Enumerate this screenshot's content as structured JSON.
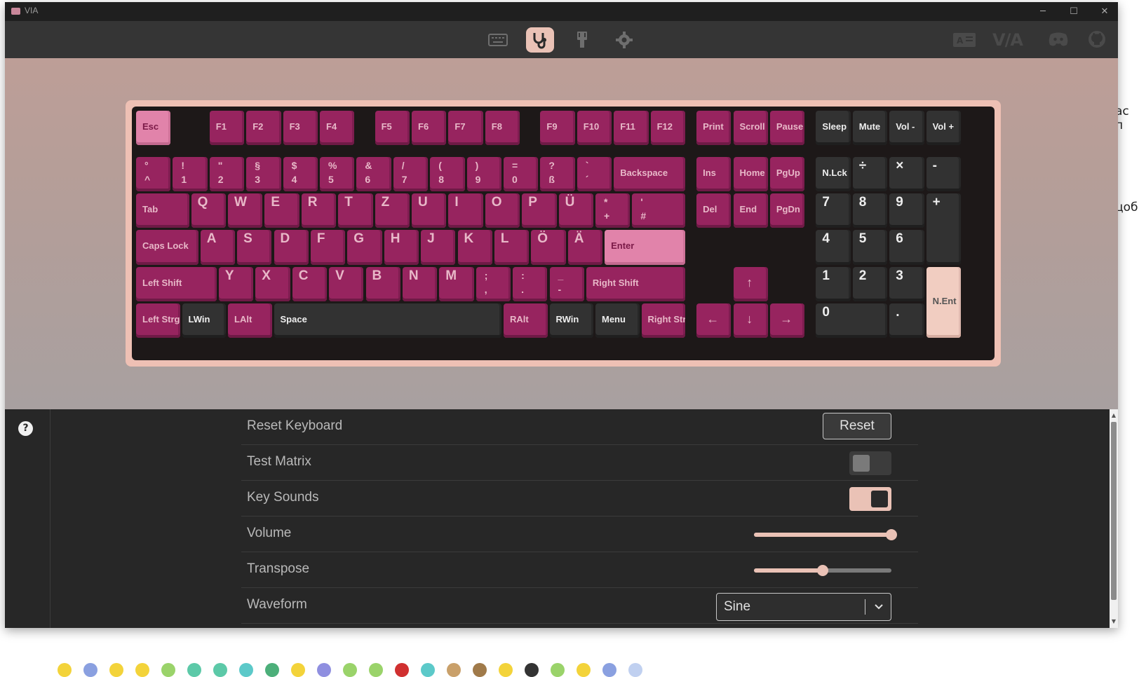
{
  "window": {
    "title": "VIA",
    "controls": {
      "minimize": "─",
      "maximize": "☐",
      "close": "✕"
    }
  },
  "nav": {
    "items": [
      {
        "name": "configure",
        "icon": "keyboard-icon",
        "active": false
      },
      {
        "name": "test",
        "icon": "stethoscope-icon",
        "active": true
      },
      {
        "name": "design",
        "icon": "design-icon",
        "active": false
      },
      {
        "name": "settings",
        "icon": "gear-icon",
        "active": false
      }
    ],
    "right_icons": [
      "language-icon",
      "via-logo",
      "discord-icon",
      "github-icon"
    ],
    "logo_text": "V/A"
  },
  "keyboard": {
    "keys": [
      {
        "l": "Esc",
        "s": "accent"
      },
      {
        "l": "F1"
      },
      {
        "l": "F2"
      },
      {
        "l": "F3"
      },
      {
        "l": "F4"
      },
      {
        "l": "F5"
      },
      {
        "l": "F6"
      },
      {
        "l": "F7"
      },
      {
        "l": "F8"
      },
      {
        "l": "F9"
      },
      {
        "l": "F10"
      },
      {
        "l": "F11"
      },
      {
        "l": "F12"
      },
      {
        "l": "Print"
      },
      {
        "l": "Scroll"
      },
      {
        "l": "Pause"
      },
      {
        "l": "Sleep",
        "s": "dark"
      },
      {
        "l": "Mute",
        "s": "dark"
      },
      {
        "l": "Vol -",
        "s": "dark"
      },
      {
        "l": "Vol +",
        "s": "dark"
      },
      {
        "t": "°",
        "b": "^"
      },
      {
        "t": "!",
        "b": "1"
      },
      {
        "t": "\"",
        "b": "2"
      },
      {
        "t": "§",
        "b": "3"
      },
      {
        "t": "$",
        "b": "4"
      },
      {
        "t": "%",
        "b": "5"
      },
      {
        "t": "&",
        "b": "6"
      },
      {
        "t": "/",
        "b": "7"
      },
      {
        "t": "(",
        "b": "8"
      },
      {
        "t": ")",
        "b": "9"
      },
      {
        "t": "=",
        "b": "0"
      },
      {
        "t": "?",
        "b": "ß"
      },
      {
        "t": "`",
        "b": "´"
      },
      {
        "l": "Backspace"
      },
      {
        "l": "Ins"
      },
      {
        "l": "Home"
      },
      {
        "l": "PgUp"
      },
      {
        "l": "N.Lck",
        "s": "dark"
      },
      {
        "l": "÷",
        "s": "dark",
        "big": true
      },
      {
        "l": "×",
        "s": "dark",
        "big": true
      },
      {
        "l": "-",
        "s": "dark",
        "big": true
      },
      {
        "l": "Tab"
      },
      {
        "l": "Q",
        "big": true
      },
      {
        "l": "W",
        "big": true
      },
      {
        "l": "E",
        "big": true
      },
      {
        "l": "R",
        "big": true
      },
      {
        "l": "T",
        "big": true
      },
      {
        "l": "Z",
        "big": true
      },
      {
        "l": "U",
        "big": true
      },
      {
        "l": "I",
        "big": true
      },
      {
        "l": "O",
        "big": true
      },
      {
        "l": "P",
        "big": true
      },
      {
        "l": "Ü",
        "big": true
      },
      {
        "t": "*",
        "b": "+"
      },
      {
        "t": "'",
        "b": "#"
      },
      {
        "l": "Del"
      },
      {
        "l": "End"
      },
      {
        "l": "PgDn"
      },
      {
        "l": "7",
        "s": "dark",
        "big": true
      },
      {
        "l": "8",
        "s": "dark",
        "big": true
      },
      {
        "l": "9",
        "s": "dark",
        "big": true
      },
      {
        "l": "+",
        "s": "dark",
        "big": true
      },
      {
        "l": "Caps Lock"
      },
      {
        "l": "A",
        "big": true
      },
      {
        "l": "S",
        "big": true
      },
      {
        "l": "D",
        "big": true
      },
      {
        "l": "F",
        "big": true
      },
      {
        "l": "G",
        "big": true
      },
      {
        "l": "H",
        "big": true
      },
      {
        "l": "J",
        "big": true
      },
      {
        "l": "K",
        "big": true
      },
      {
        "l": "L",
        "big": true
      },
      {
        "l": "Ö",
        "big": true
      },
      {
        "l": "Ä",
        "big": true
      },
      {
        "l": "Enter",
        "s": "accent"
      },
      {
        "l": "4",
        "s": "dark",
        "big": true
      },
      {
        "l": "5",
        "s": "dark",
        "big": true
      },
      {
        "l": "6",
        "s": "dark",
        "big": true
      },
      {
        "l": "Left Shift"
      },
      {
        "l": "Y",
        "big": true
      },
      {
        "l": "X",
        "big": true
      },
      {
        "l": "C",
        "big": true
      },
      {
        "l": "V",
        "big": true
      },
      {
        "l": "B",
        "big": true
      },
      {
        "l": "N",
        "big": true
      },
      {
        "l": "M",
        "big": true
      },
      {
        "t": ";",
        "b": ","
      },
      {
        "t": ":",
        "b": "."
      },
      {
        "t": "_",
        "b": "-"
      },
      {
        "l": "Right Shift"
      },
      {
        "l": "↑",
        "arrow": true
      },
      {
        "l": "1",
        "s": "dark",
        "big": true
      },
      {
        "l": "2",
        "s": "dark",
        "big": true
      },
      {
        "l": "3",
        "s": "dark",
        "big": true
      },
      {
        "l": "N.Ent",
        "s": "pale"
      },
      {
        "l": "Left Strg"
      },
      {
        "l": "LWin",
        "s": "dark"
      },
      {
        "l": "LAlt"
      },
      {
        "l": "Space",
        "s": "dark"
      },
      {
        "l": "RAlt"
      },
      {
        "l": "RWin",
        "s": "dark"
      },
      {
        "l": "Menu",
        "s": "dark"
      },
      {
        "l": "Right Str"
      },
      {
        "l": "←",
        "arrow": true
      },
      {
        "l": "↓",
        "arrow": true
      },
      {
        "l": "→",
        "arrow": true
      },
      {
        "l": "0",
        "s": "dark",
        "big": true
      },
      {
        "l": ".",
        "s": "dark",
        "big": true
      }
    ]
  },
  "settings": {
    "help_label": "?",
    "reset_keyboard": {
      "label": "Reset Keyboard",
      "button": "Reset"
    },
    "test_matrix": {
      "label": "Test Matrix",
      "enabled": false
    },
    "key_sounds": {
      "label": "Key Sounds",
      "enabled": true
    },
    "volume": {
      "label": "Volume",
      "value": 1.0
    },
    "transpose": {
      "label": "Transpose",
      "value": 0.5
    },
    "waveform": {
      "label": "Waveform",
      "value": "Sine"
    }
  },
  "background_text": {
    "right_1": "ас п",
    "right_2": "цоб"
  },
  "colors": {
    "accent": "#eac2b6",
    "keycap": "#97245f",
    "keycap_dark": "#323232",
    "keycap_accent": "#e183aa"
  }
}
